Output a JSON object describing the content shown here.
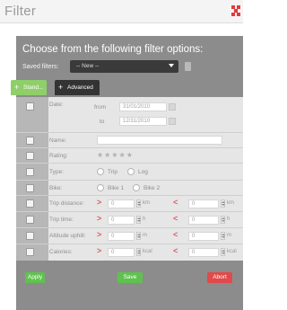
{
  "window": {
    "title": "Filter",
    "close_icon": "close-icon",
    "accent_close": "#e23a3a"
  },
  "header": {
    "heading": "Choose from the following filter options:",
    "saved_filters_label": "Saved filters:",
    "saved_filters_value": "-- New --"
  },
  "tabs": [
    {
      "label": "Stand..."
    },
    {
      "label": "Advanced"
    }
  ],
  "fields": {
    "date": {
      "label": "Date:",
      "from_label": "from",
      "from_value": "31/01/2010",
      "to_label": "to",
      "to_value": "12/31/2010"
    },
    "name": {
      "label": "Name:",
      "value": ""
    },
    "rating": {
      "label": "Rating:",
      "stars": "★★★★★"
    },
    "type": {
      "label": "Type:",
      "opt1": "Trip",
      "opt2": "Log"
    },
    "bike": {
      "label": "Bike:",
      "opt1": "Bike 1",
      "opt2": "Bike 2"
    },
    "trip_distance": {
      "label": "Trip distance:",
      "gt": ">",
      "min": "0",
      "min_unit": "km",
      "lt": "<",
      "max": "0",
      "max_unit": "km"
    },
    "trip_time": {
      "label": "Trip time:",
      "gt": ">",
      "min": "0",
      "min_unit": "h",
      "lt": "<",
      "max": "0",
      "max_unit": "h"
    },
    "altitude_uphill": {
      "label": "Altitude uphill:",
      "gt": ">",
      "min": "0",
      "min_unit": "m",
      "lt": "<",
      "max": "0",
      "max_unit": "m"
    },
    "calories": {
      "label": "Calories:",
      "gt": ">",
      "min": "0",
      "min_unit": "kcal",
      "lt": "<",
      "max": "0",
      "max_unit": "kcal"
    }
  },
  "footer": {
    "apply": "Apply",
    "save": "Save",
    "abort": "Abort"
  },
  "colors": {
    "green": "#5fc24f",
    "red": "#e04a4a",
    "gray_header": "#8c8c8c"
  }
}
